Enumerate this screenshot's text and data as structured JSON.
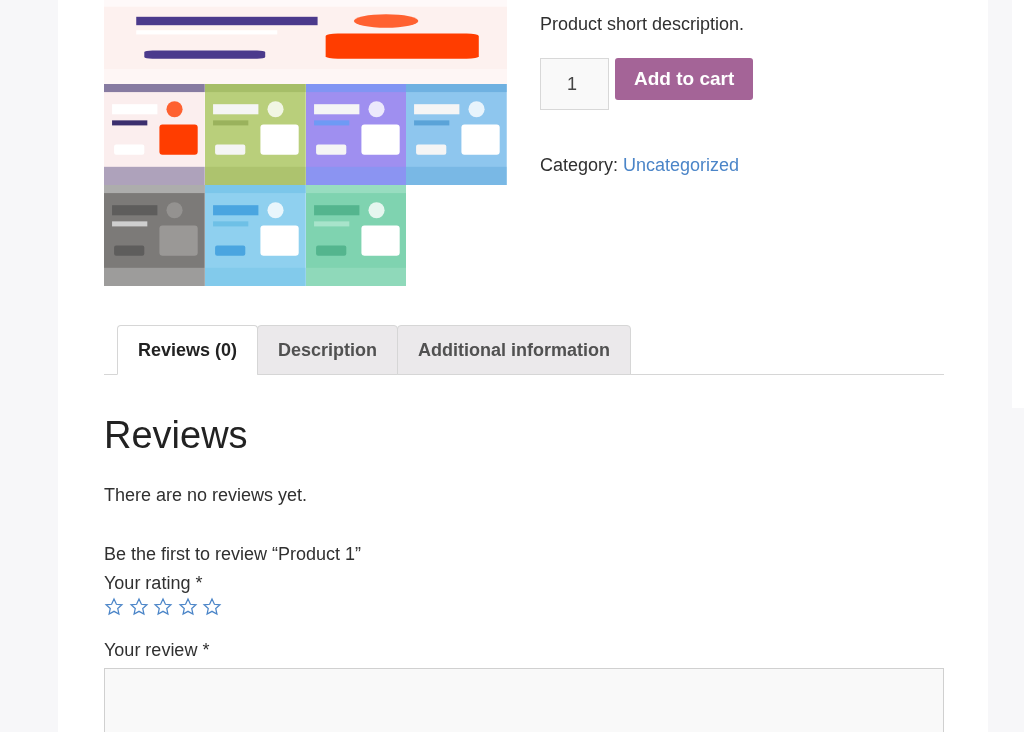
{
  "product": {
    "short_description": "Product short description.",
    "quantity": "1",
    "add_to_cart": "Add to cart",
    "category_label": "Category:",
    "category": "Uncategorized"
  },
  "tabs": [
    {
      "label": "Reviews (0)",
      "selected": true
    },
    {
      "label": "Description",
      "selected": false
    },
    {
      "label": "Additional information",
      "selected": false
    }
  ],
  "reviews": {
    "heading": "Reviews",
    "empty_message": "There are no reviews yet.",
    "form_title": "Be the first to review “Product 1”",
    "rating_label": "Your rating *",
    "stars": 0,
    "star_buttons": [
      {
        "selected": false
      },
      {
        "selected": false
      },
      {
        "selected": false
      },
      {
        "selected": false
      },
      {
        "selected": false
      }
    ],
    "review_label": "Your review *"
  }
}
